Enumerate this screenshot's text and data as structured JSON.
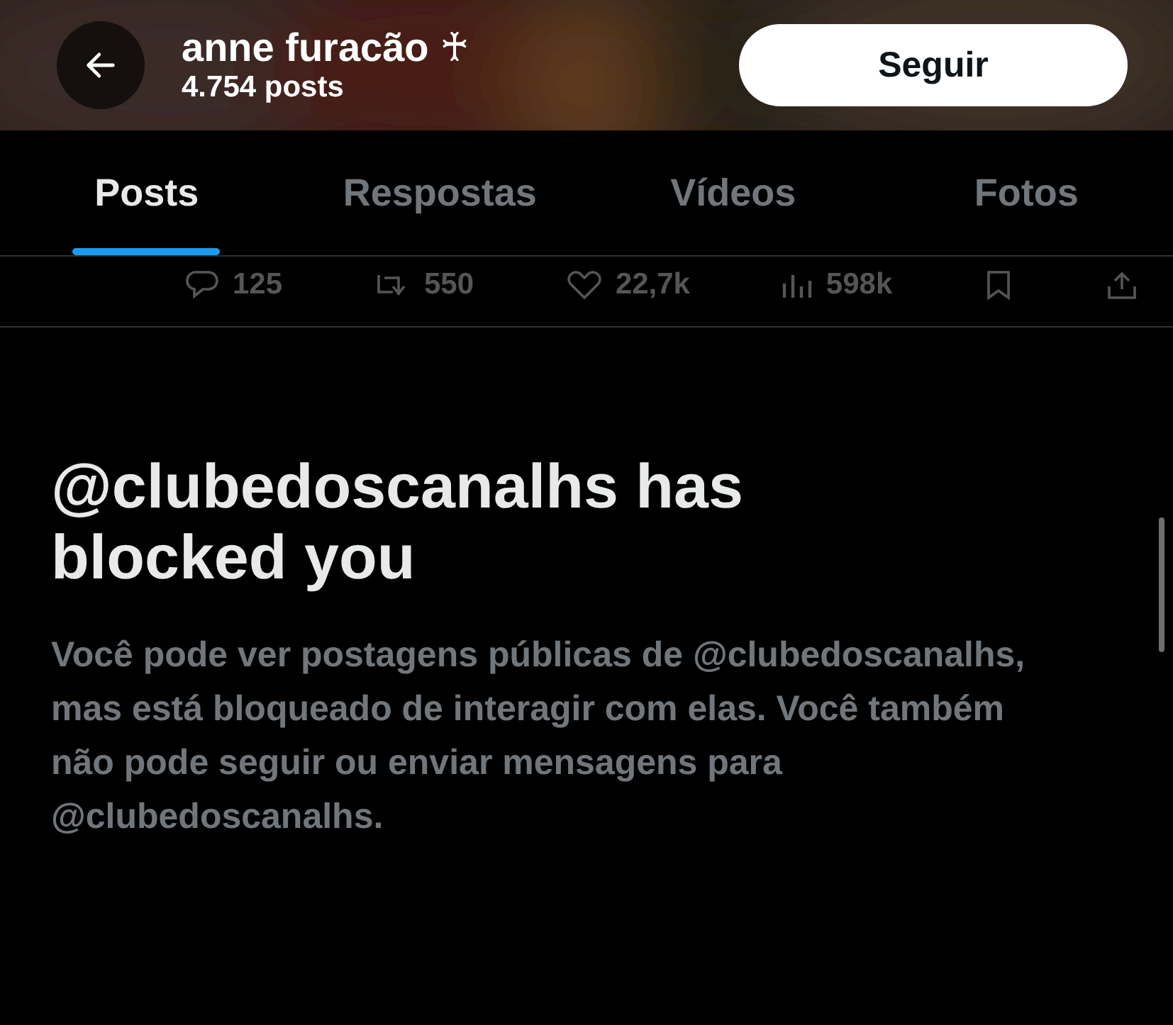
{
  "header": {
    "name": "anne furacão ♰",
    "post_count": "4.754 posts",
    "follow_button": "Seguir"
  },
  "tabs": [
    {
      "label": "Posts",
      "selected": true
    },
    {
      "label": "Respostas",
      "selected": false
    },
    {
      "label": "Vídeos",
      "selected": false
    },
    {
      "label": "Fotos",
      "selected": false
    }
  ],
  "post_actions": [
    {
      "kind": "reply",
      "count": "125"
    },
    {
      "kind": "repost",
      "count": "550"
    },
    {
      "kind": "like",
      "count": "22,7k"
    },
    {
      "kind": "views",
      "count": "598k"
    },
    {
      "kind": "bookmark"
    },
    {
      "kind": "share"
    }
  ],
  "blocked_notice": {
    "title": "@clubedoscanalhs has blocked you",
    "body": "Você pode ver postagens públicas de @clubedoscanalhs, mas está bloqueado de interagir com elas. Você também não pode seguir ou enviar mensagens para @clubedoscanalhs."
  }
}
